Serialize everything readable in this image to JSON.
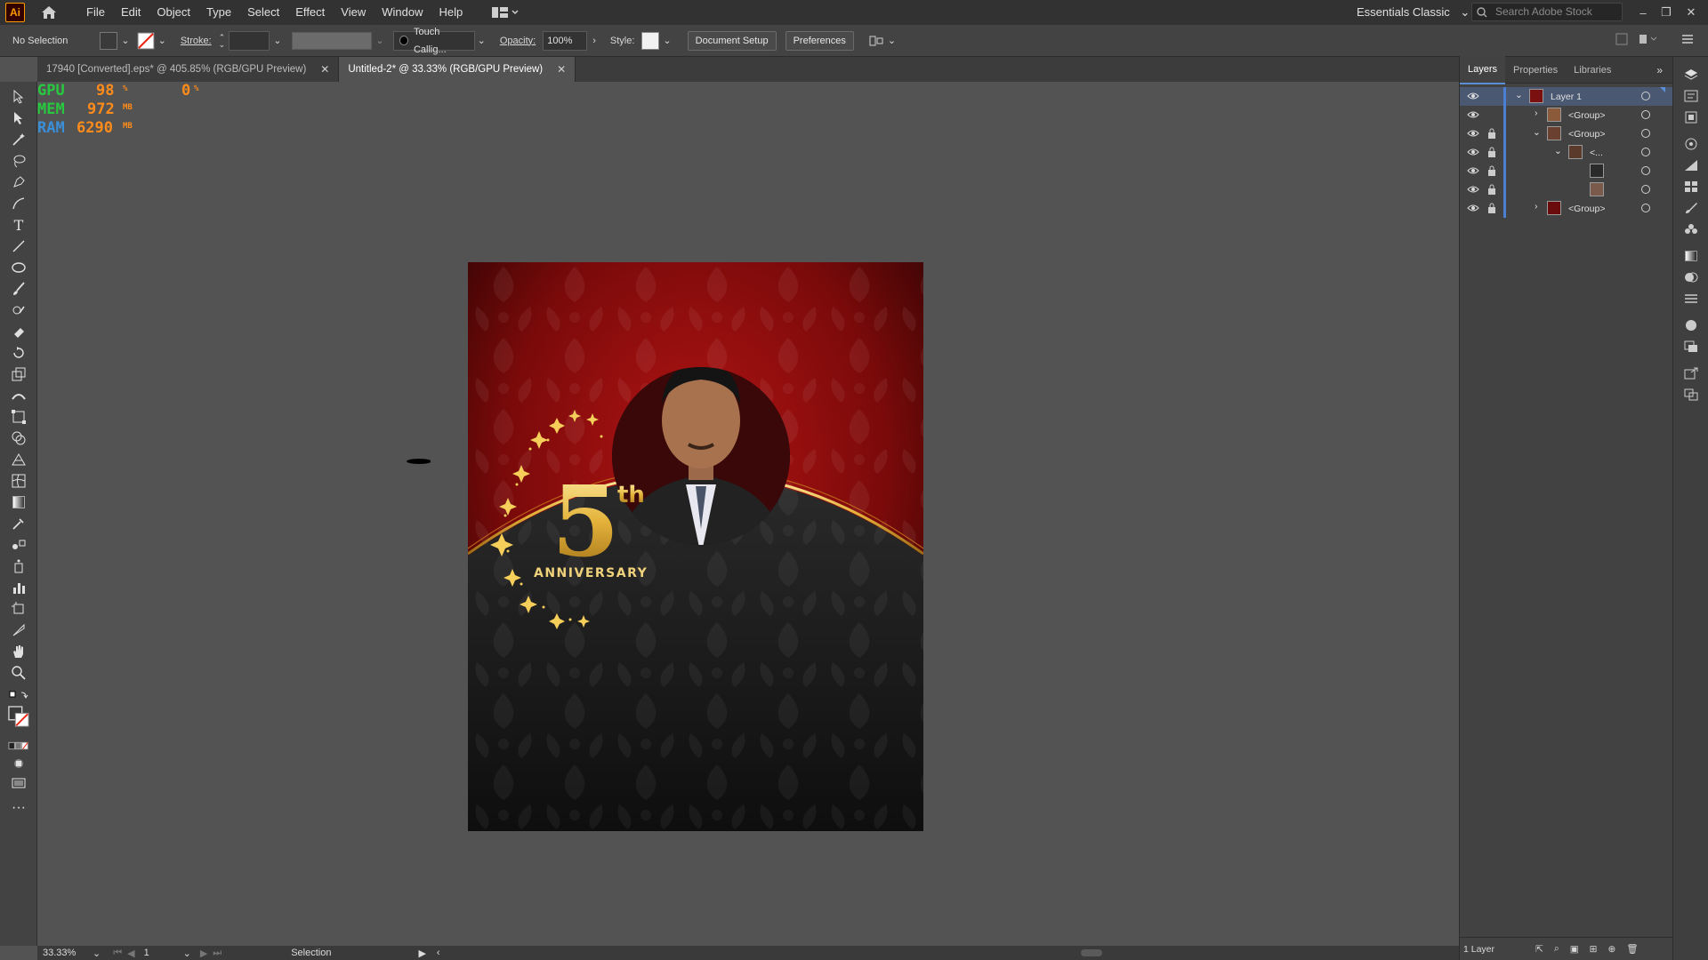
{
  "app": {
    "logo": "Ai"
  },
  "menu": [
    "File",
    "Edit",
    "Object",
    "Type",
    "Select",
    "Effect",
    "View",
    "Window",
    "Help"
  ],
  "workspace": {
    "label": "Essentials Classic",
    "search_placeholder": "Search Adobe Stock"
  },
  "control_bar": {
    "selection": "No Selection",
    "stroke_label": "Stroke:",
    "brush": "Touch Callig...",
    "opacity_label": "Opacity:",
    "opacity_value": "100%",
    "style_label": "Style:",
    "document_setup": "Document Setup",
    "preferences": "Preferences"
  },
  "tabs": [
    {
      "label": "17940 [Converted].eps* @ 405.85% (RGB/GPU Preview)",
      "active": false
    },
    {
      "label": "Untitled-2* @ 33.33% (RGB/GPU Preview)",
      "active": true
    }
  ],
  "perf": {
    "gpu_label": "GPU",
    "gpu_value": "98",
    "gpu_unit": "%",
    "gpu2_value": "0",
    "gpu2_unit": "%",
    "mem_label": "MEM",
    "mem_value": "972",
    "mem_unit": "MB",
    "ram_label": "RAM",
    "ram_value": "6290",
    "ram_unit": "MB"
  },
  "artwork": {
    "number": "5",
    "suffix": "th",
    "word": "ANNIVERSARY"
  },
  "status": {
    "zoom": "33.33%",
    "artboard": "1",
    "tool": "Selection"
  },
  "panel": {
    "tabs": [
      "Layers",
      "Properties",
      "Libraries"
    ],
    "layers": [
      {
        "name": "Layer 1",
        "depth": 0,
        "expanded": true,
        "selected": true,
        "locked": false
      },
      {
        "name": "<Group>",
        "depth": 1,
        "expanded": false,
        "selected": false,
        "locked": false
      },
      {
        "name": "<Group>",
        "depth": 1,
        "expanded": true,
        "selected": false,
        "locked": true
      },
      {
        "name": "<...",
        "depth": 2,
        "expanded": true,
        "selected": false,
        "locked": true
      },
      {
        "name": "",
        "depth": 3,
        "expanded": false,
        "selected": false,
        "locked": true
      },
      {
        "name": "",
        "depth": 3,
        "expanded": false,
        "selected": false,
        "locked": true
      },
      {
        "name": "<Group>",
        "depth": 1,
        "expanded": false,
        "selected": false,
        "locked": true
      }
    ],
    "footer": "1 Layer"
  },
  "colors": {
    "accent": "#4b7fd1",
    "gpu": "#27c93f",
    "mem": "#ff8c1a",
    "ram": "#3a8fd9",
    "gold": "#f0c04a"
  }
}
